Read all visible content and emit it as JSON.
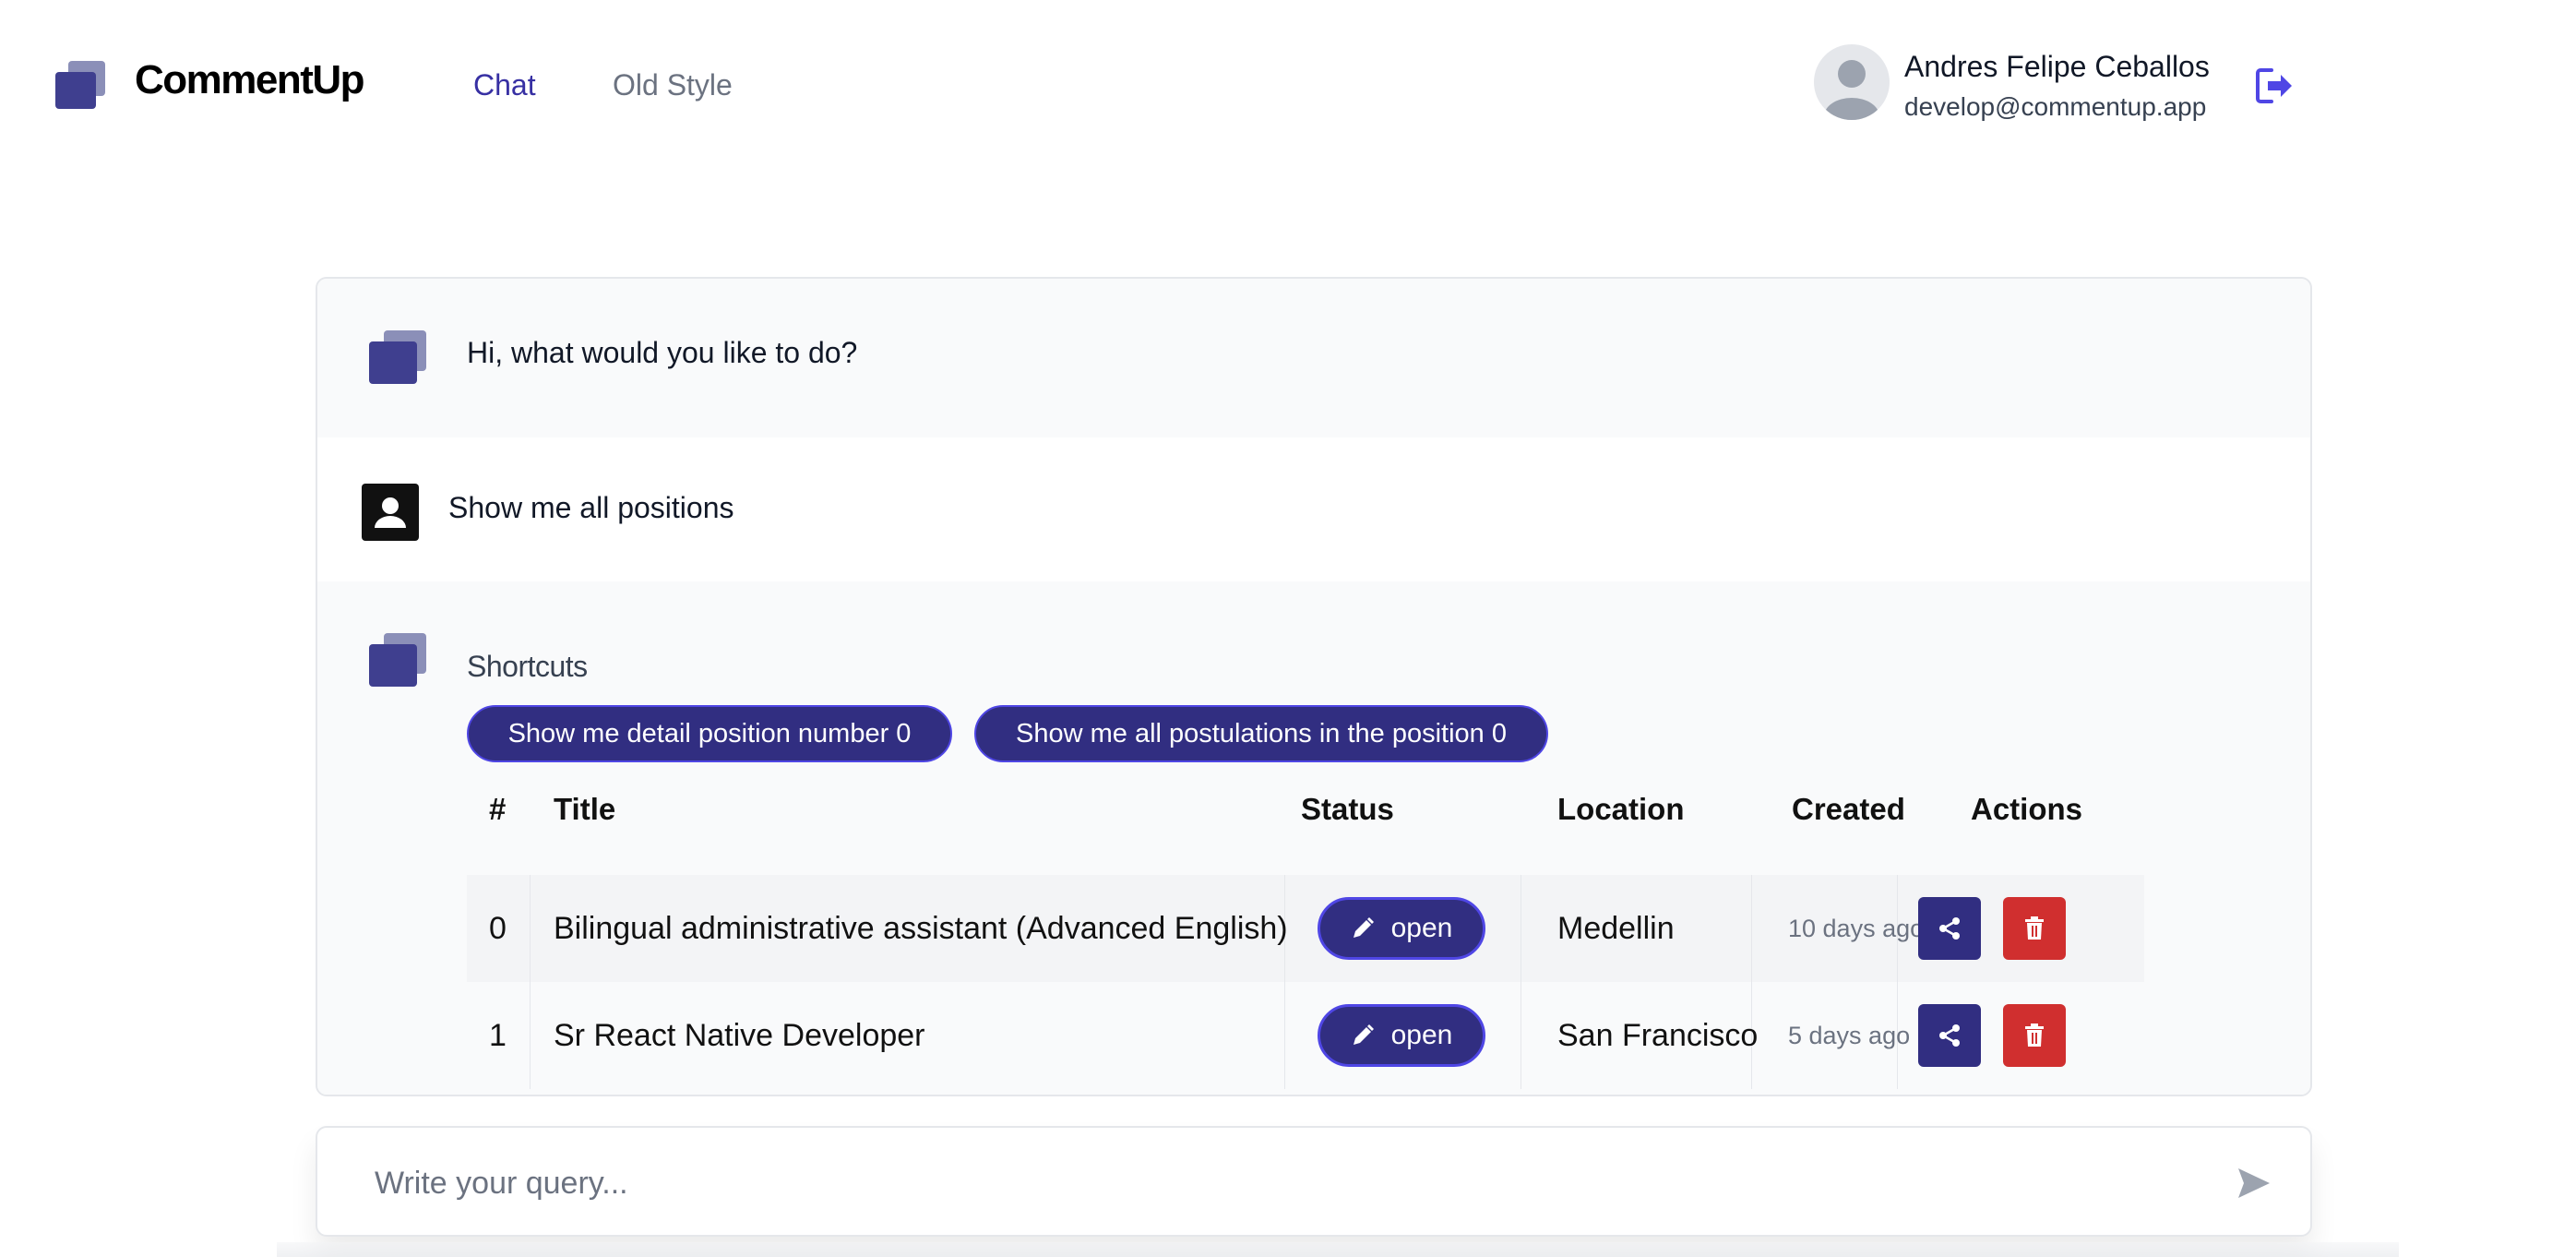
{
  "colors": {
    "accent": "#312e81",
    "accent_border": "#4f46e5",
    "danger": "#d02f2f",
    "nav_active": "#3730a3"
  },
  "header": {
    "brand": "CommentUp",
    "nav": {
      "chat": "Chat",
      "old_style": "Old Style"
    },
    "user": {
      "name": "Andres Felipe Ceballos",
      "email": "develop@commentup.app"
    }
  },
  "chat": {
    "greeting": "Hi, what would you like to do?",
    "user_message": "Show me all positions",
    "shortcuts_label": "Shortcuts",
    "shortcuts": [
      "Show me detail position number 0",
      "Show me all postulations in the position 0"
    ],
    "table": {
      "headers": {
        "num": "#",
        "title": "Title",
        "status": "Status",
        "location": "Location",
        "created": "Created",
        "actions": "Actions"
      },
      "rows": [
        {
          "num": "0",
          "title": "Bilingual administrative assistant (Advanced English)",
          "status": "open",
          "location": "Medellin",
          "created": "10 days ago"
        },
        {
          "num": "1",
          "title": "Sr React Native Developer",
          "status": "open",
          "location": "San Francisco",
          "created": "5 days ago"
        }
      ]
    }
  },
  "query": {
    "placeholder": "Write your query..."
  },
  "icons": {
    "logo": "stacked-squares-logo",
    "avatar": "user-avatar-icon",
    "logout": "logout-icon",
    "user": "person-icon",
    "edit": "pencil-icon",
    "share": "share-icon",
    "delete": "trash-icon",
    "send": "send-icon"
  }
}
